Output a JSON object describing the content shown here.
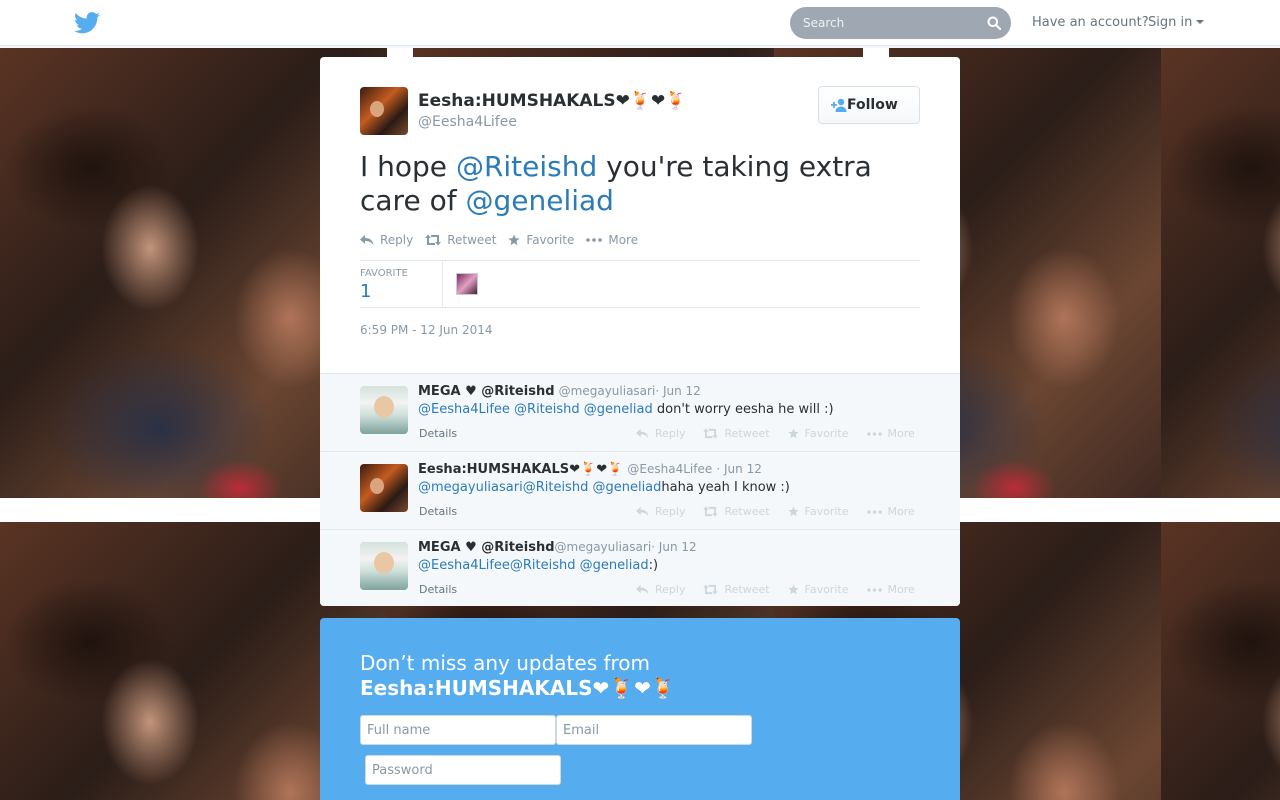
{
  "header": {
    "search_placeholder": "Search",
    "have_account": "Have an account?",
    "sign_in": "Sign in"
  },
  "tweet": {
    "fullname": "Eesha:HUMSHAKALS❤🍹❤🍹",
    "screenname": "@Eesha4Lifee",
    "follow_label": "Follow",
    "text_1": "I hope ",
    "mention_1": "@Riteishd",
    "text_2": " you're taking extra care of ",
    "mention_2": "@geneliad",
    "actions": {
      "reply": "Reply",
      "retweet": "Retweet",
      "favorite": "Favorite",
      "more": "More"
    },
    "stats": {
      "label": "FAVORITE",
      "value": "1"
    },
    "timestamp": "6:59 PM - 12 Jun 2014"
  },
  "replies": [
    {
      "name": "MEGA ♥ @Riteishd",
      "handle": "@megayuliasari",
      "date": "· Jun 12",
      "mentions": [
        "@Eesha4Lifee",
        "@Riteishd",
        "@geneliad"
      ],
      "text": "don't worry eesha he will :)",
      "details": "Details"
    },
    {
      "name": "Eesha:HUMSHAKALS❤🍹❤🍹",
      "handle": "@Eesha4Lifee",
      "date": "· Jun 12",
      "mentions": [
        "@megayuliasari",
        "@Riteishd",
        "@geneliad"
      ],
      "text": "haha yeah I know :)",
      "details": "Details"
    },
    {
      "name": "MEGA ♥ @Riteishd",
      "handle": "@megayuliasari",
      "date": "· Jun 12",
      "mentions": [
        "@Eesha4Lifee",
        "@Riteishd",
        "@geneliad"
      ],
      "text": ":)",
      "details": "Details"
    }
  ],
  "signup": {
    "title": "Don’t miss any updates from",
    "name": "Eesha:HUMSHAKALS❤🍹❤🍹",
    "fullname_placeholder": "Full name",
    "email_placeholder": "Email",
    "password_placeholder": "Password"
  },
  "colors": {
    "accent_link": "#2b7bb9",
    "twitter_blue": "#55acee",
    "muted": "#8899a6"
  }
}
